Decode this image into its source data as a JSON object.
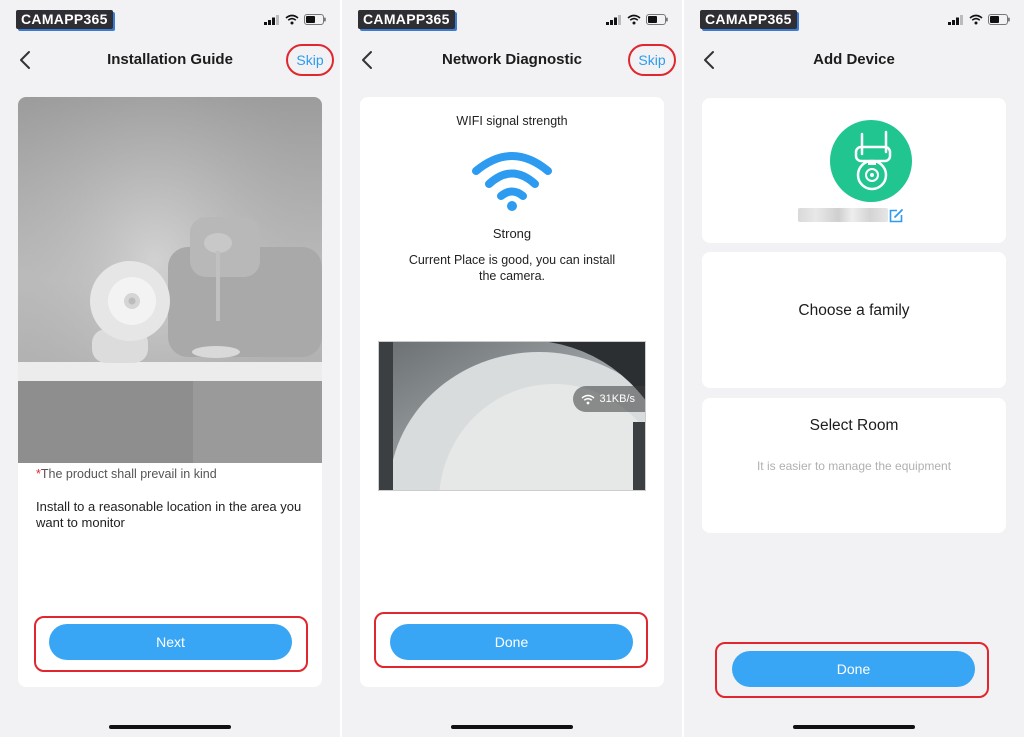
{
  "watermark": "CAMAPP365",
  "colors": {
    "accent": "#2d9cf0",
    "button": "#38a6f5",
    "highlight": "#e0262e",
    "device_bg": "#21c58f"
  },
  "screens": [
    {
      "title": "Installation Guide",
      "skip_label": "Skip",
      "note_star": "*",
      "note": "The product shall prevail in kind",
      "instruction": "Install to a reasonable location in the area you want to monitor",
      "button_label": "Next"
    },
    {
      "title": "Network Diagnostic",
      "skip_label": "Skip",
      "wifi_heading": "WIFI signal strength",
      "signal_level": "Strong",
      "signal_message": "Current Place is good, you can install the camera.",
      "speed": "31KB/s",
      "button_label": "Done"
    },
    {
      "title": "Add Device",
      "family_label": "Choose a family",
      "room_label": "Select Room",
      "room_hint": "It is easier to manage the equipment",
      "button_label": "Done"
    }
  ],
  "icons": [
    "signal-icon",
    "wifi-icon",
    "battery-icon",
    "back-chevron-icon",
    "wifi-strength-icon",
    "camera-icon",
    "edit-icon"
  ]
}
